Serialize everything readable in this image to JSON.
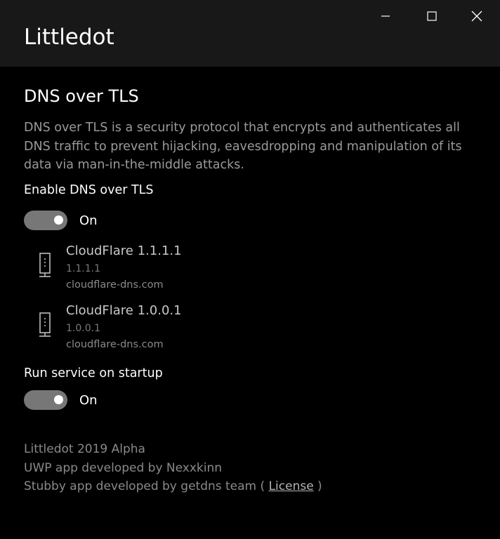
{
  "window": {
    "title": "Littledot",
    "controls": {
      "minimize": "minimize-icon",
      "maximize": "maximize-icon",
      "close": "close-icon"
    }
  },
  "dot_section": {
    "title": "DNS over TLS",
    "description": "DNS over TLS is a security protocol that encrypts and authenticates all DNS traffic to prevent hijacking, eavesdropping and manipulation of its data via man-in-the-middle attacks.",
    "enable_label": "Enable DNS over TLS",
    "enable_state": "On",
    "servers": [
      {
        "name": "CloudFlare 1.1.1.1",
        "ip": "1.1.1.1",
        "host": "cloudflare-dns.com",
        "icon": "server-icon"
      },
      {
        "name": "CloudFlare 1.0.0.1",
        "ip": "1.0.0.1",
        "host": "cloudflare-dns.com",
        "icon": "server-icon"
      }
    ],
    "startup_label": "Run service on startup",
    "startup_state": "On"
  },
  "footer": {
    "line1": "Littledot 2019 Alpha",
    "line2": "UWP app developed by Nexxkinn",
    "line3_prefix": "Stubby app developed by getdns team ( ",
    "license_link": "License",
    "line3_suffix": " )"
  },
  "colors": {
    "background": "#000000",
    "titlebar": "#181818",
    "toggle_track": "#777777",
    "secondary_text": "#9a9a9a"
  }
}
